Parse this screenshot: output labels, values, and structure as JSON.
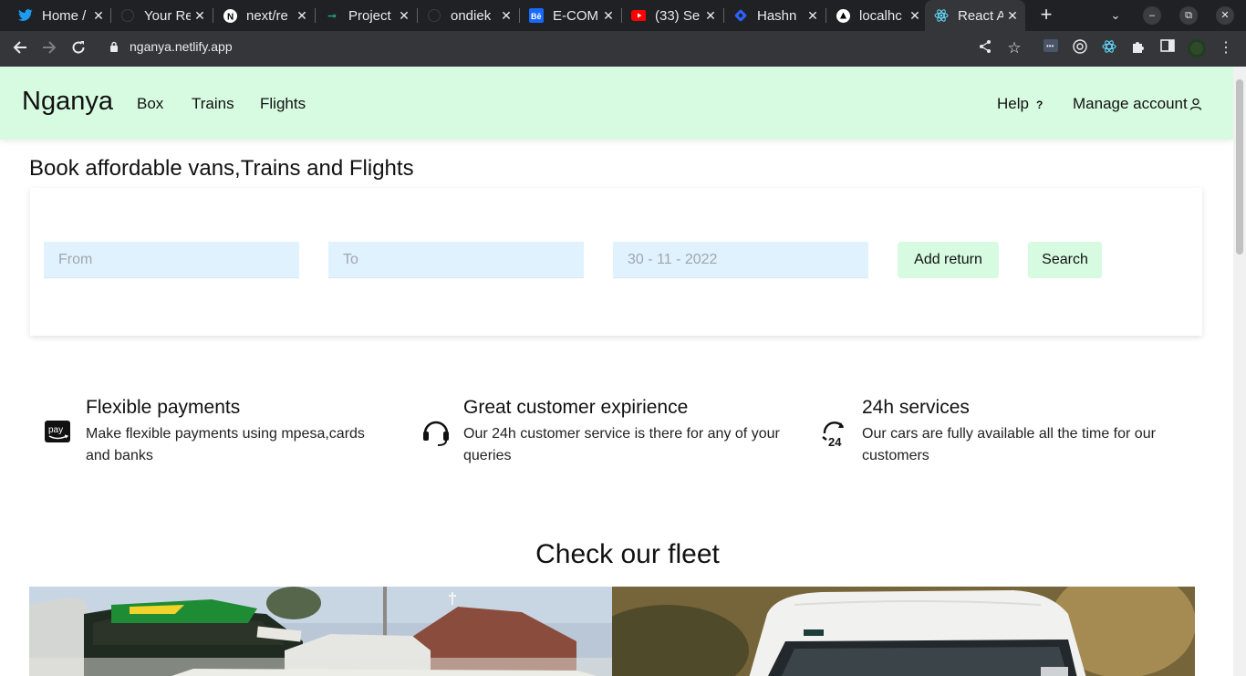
{
  "browser": {
    "tabs": [
      {
        "title": "Home /",
        "icon": "twitter-icon",
        "color": "#1d9bf0"
      },
      {
        "title": "Your Re",
        "icon": "github-icon",
        "color": "#e8eaed"
      },
      {
        "title": "next/re",
        "icon": "nextjs-icon",
        "color": "#ffffff"
      },
      {
        "title": "Project",
        "icon": "project-icon",
        "color": "#2aa198"
      },
      {
        "title": "ondiek",
        "icon": "github-icon",
        "color": "#e8eaed"
      },
      {
        "title": "E-COM",
        "icon": "behance-icon",
        "color": "#1769ff"
      },
      {
        "title": "(33) Se",
        "icon": "youtube-icon",
        "color": "#ff0000"
      },
      {
        "title": "Hashn",
        "icon": "hashnode-icon",
        "color": "#2962ff"
      },
      {
        "title": "localhc",
        "icon": "vercel-icon",
        "color": "#ffffff"
      },
      {
        "title": "React A",
        "icon": "react-icon",
        "color": "#61dafb"
      }
    ],
    "url": "nganya.netlify.app"
  },
  "header": {
    "logo": "Nganya",
    "nav": [
      "Box",
      "Trains",
      "Flights"
    ],
    "help": "Help",
    "help_mark": "?",
    "account": "Manage account"
  },
  "heading": "Book affordable vans,Trains and Flights",
  "search": {
    "from_placeholder": "From",
    "to_placeholder": "To",
    "date": "30 - 11 - 2022",
    "add_return": "Add return",
    "search": "Search"
  },
  "features": [
    {
      "title": "Flexible payments",
      "desc": "Make flexible payments using mpesa,cards and banks",
      "icon": "amazon-pay-icon"
    },
    {
      "title": "Great customer expirience",
      "desc": "Our 24h customer service is there for any of your queries",
      "icon": "headset-icon"
    },
    {
      "title": "24h services",
      "desc": "Our cars are fully available all the time for our customers",
      "icon": "24h-icon"
    }
  ],
  "fleet_title": "Check our fleet",
  "colors": {
    "header_bg": "#d7fbe1",
    "input_bg": "#e1f2ff",
    "button_bg": "#d7fbe1"
  }
}
